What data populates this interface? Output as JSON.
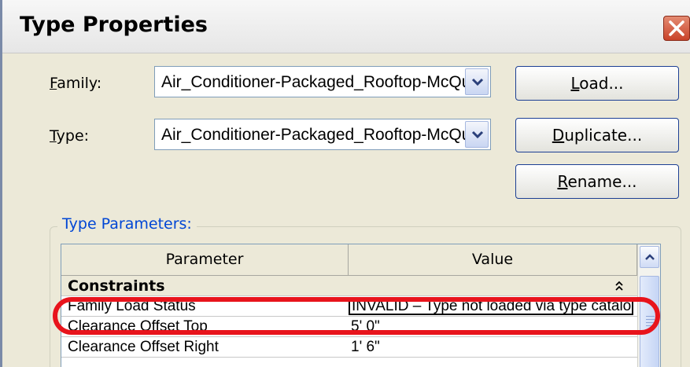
{
  "window": {
    "title": "Type Properties"
  },
  "family": {
    "label_key": "F",
    "label_rest": "amily:",
    "value": "Air_Conditioner-Packaged_Rooftop-McQuay"
  },
  "type": {
    "label_key": "T",
    "label_rest": "ype:",
    "value": "Air_Conditioner-Packaged_Rooftop-McQuay"
  },
  "buttons": {
    "load": {
      "key": "L",
      "rest": "oad..."
    },
    "duplicate": {
      "key": "D",
      "rest": "uplicate..."
    },
    "rename": {
      "key": "R",
      "rest": "ename..."
    }
  },
  "type_parameters": {
    "group_label": "Type Parameters:",
    "columns": {
      "parameter": "Parameter",
      "value": "Value"
    },
    "category": "Constraints",
    "rows": [
      {
        "parameter": "Family Load Status",
        "value": "INVALID – Type not loaded via type catalog"
      },
      {
        "parameter": "Clearance Offset Top",
        "value": "5'  0\""
      },
      {
        "parameter": "Clearance Offset Right",
        "value": "1'  6\""
      }
    ]
  },
  "colors": {
    "highlight_ring": "#e8141c",
    "group_label": "#0046d5",
    "close_button": "#c9432a"
  },
  "icons": [
    "close-icon",
    "chevron-down-icon",
    "chevron-up-icon",
    "collapse-icon"
  ]
}
